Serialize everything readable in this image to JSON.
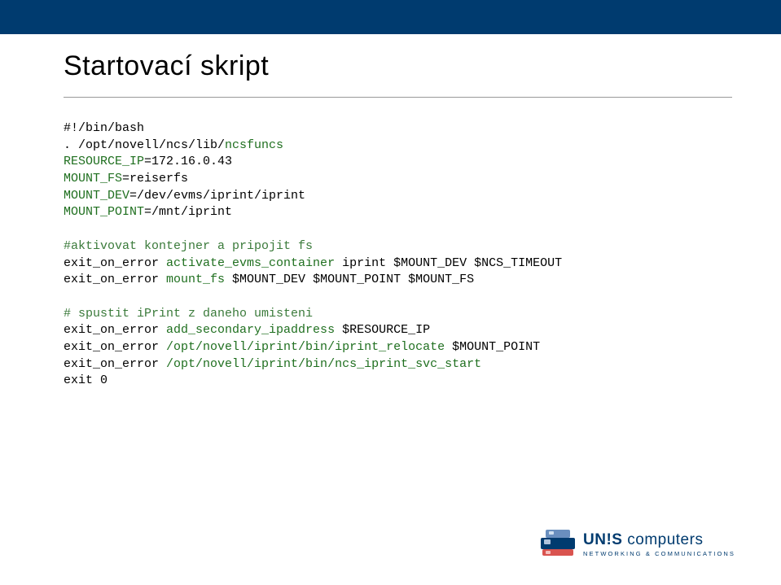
{
  "title": "Startovací skript",
  "code": {
    "l1": "#!/bin/bash",
    "l2a": ". /opt/novell/ncs/lib/",
    "l2b": "ncsfuncs",
    "l3a": "RESOURCE_IP",
    "l3b": "=172.16.0.43",
    "l4a": "MOUNT_FS",
    "l4b": "=reiserfs",
    "l5a": "MOUNT_DEV",
    "l5b": "=/dev/evms/iprint/iprint",
    "l6a": "MOUNT_POINT",
    "l6b": "=/mnt/iprint",
    "c1": "#aktivovat kontejner a pripojit fs",
    "l7a": "exit_on_error ",
    "l7b": "activate_evms_container",
    "l7c": " iprint $MOUNT_DEV $NCS_TIMEOUT",
    "l8a": "exit_on_error ",
    "l8b": "mount_fs",
    "l8c": " $MOUNT_DEV $MOUNT_POINT $MOUNT_FS",
    "c2": "# spustit iPrint z daneho umisteni",
    "l9a": "exit_on_error ",
    "l9b": "add_secondary_ipaddress",
    "l9c": " $RESOURCE_IP",
    "l10a": "exit_on_error ",
    "l10b": "/opt/novell/iprint/bin/iprint_relocate",
    "l10c": " $MOUNT_POINT",
    "l11a": "exit_on_error ",
    "l11b": "/opt/novell/iprint/bin/ncs_iprint_svc_start",
    "l12": "exit 0"
  },
  "logo": {
    "brand": "UN!S",
    "product": "computers",
    "tagline": "NETWORKING & COMMUNICATIONS"
  }
}
